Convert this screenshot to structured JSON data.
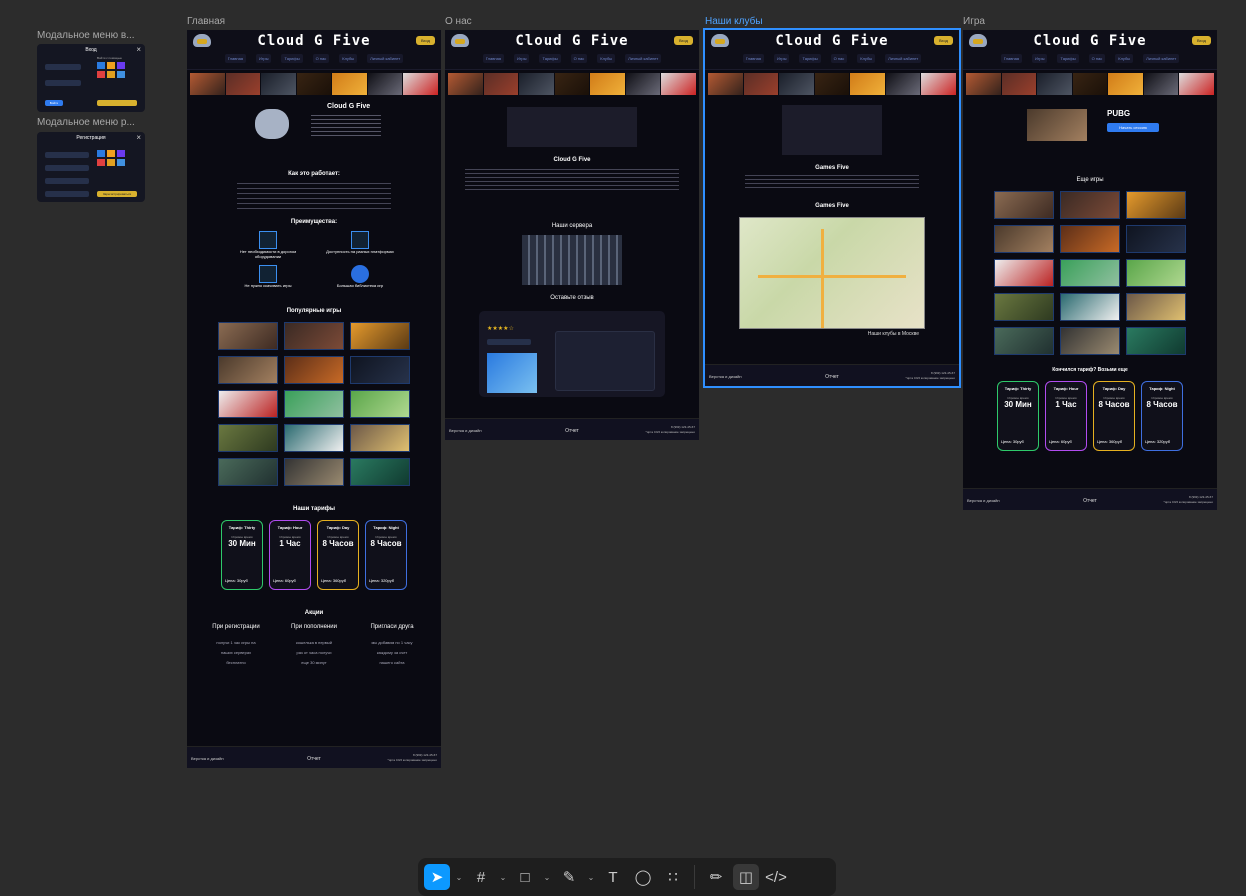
{
  "canvas": {
    "frame_labels": {
      "modal_login": "Модальное меню в...",
      "modal_register": "Модальное меню р...",
      "home": "Главная",
      "about": "О нас",
      "clubs": "Наши клубы",
      "game": "Игра"
    }
  },
  "site": {
    "brand": "Cloud G Five",
    "login_btn": "Вход",
    "nav": [
      "Главная",
      "Игры",
      "Тарифы",
      "О нас",
      "Клубы",
      "Личный кабинет"
    ]
  },
  "modal_login": {
    "title": "Вход",
    "close": "×",
    "submit": "Войти",
    "alt_title": "Войти с помощью"
  },
  "modal_register": {
    "title": "Регистрация",
    "close": "×",
    "submit": "Зарегистрироваться"
  },
  "home": {
    "hero_title": "Cloud G Five",
    "how_title": "Как это работает:",
    "adv_title": "Преимущества:",
    "advantages": [
      "Нет необходимости в дорогом оборудовании",
      "Доступность на разных платформах",
      "Не нужно скачивать игры",
      "Большая библиотека игр"
    ],
    "popular_title": "Популярные игры",
    "tariffs_title": "Наши тарифы",
    "promo_title": "Акции",
    "promos": [
      {
        "title": "При регистрации",
        "lines": [
          "получи 1 час игры на",
          "наших серверах",
          "бесплатно"
        ]
      },
      {
        "title": "При пополнении",
        "lines": [
          "кошелька в первый",
          "раз от часа получи",
          "еще 30 минут"
        ]
      },
      {
        "title": "Пригласи друга",
        "lines": [
          "мы добавим по 1 часу",
          "каждому за счет",
          "нашего сайта"
        ]
      }
    ]
  },
  "tariffs": [
    {
      "name": "Тариф: Thirty",
      "label": "Игровое время",
      "value": "30 Мин",
      "price": "Цена: 30руб",
      "color": "#2ec96a"
    },
    {
      "name": "Тариф: Hour",
      "label": "Игровое время",
      "value": "1 Час",
      "price": "Цена: 60руб",
      "color": "#b14cf0"
    },
    {
      "name": "Тариф: Day",
      "label": "Игровое время",
      "value": "8 Часов",
      "price": "Цена: 360руб",
      "color": "#e5b020"
    },
    {
      "name": "Тариф: Night",
      "label": "Игровое время",
      "value": "8 Часов",
      "price": "Цена: 320руб",
      "color": "#3f6fe0"
    }
  ],
  "about": {
    "title": "Cloud G Five",
    "servers_title": "Наши сервера",
    "review_title": "Оставьте отзыв",
    "stars": "★★★★☆"
  },
  "clubs": {
    "title": "Games Five",
    "map_title": "Games Five",
    "map_caption": "Наши клубы в Москве"
  },
  "game": {
    "title": "PUBG",
    "play_btn": "Начать сессию",
    "more_title": "Еще игры",
    "tariff_question": "Кончился тариф? Возьми еще"
  },
  "footer": {
    "left": "Верстка и дизайн",
    "center": "Отчет",
    "phone": "8 (999) 123-45-67",
    "rights": "*ирта CG5 копирование запрещено"
  },
  "toolbar": {
    "tools": [
      "move-tool",
      "frame-tool",
      "shape-tool",
      "pen-tool",
      "text-tool",
      "comment-tool",
      "actions-tool",
      "draw-mode",
      "design-mode",
      "dev-mode"
    ],
    "active": "move-tool"
  }
}
